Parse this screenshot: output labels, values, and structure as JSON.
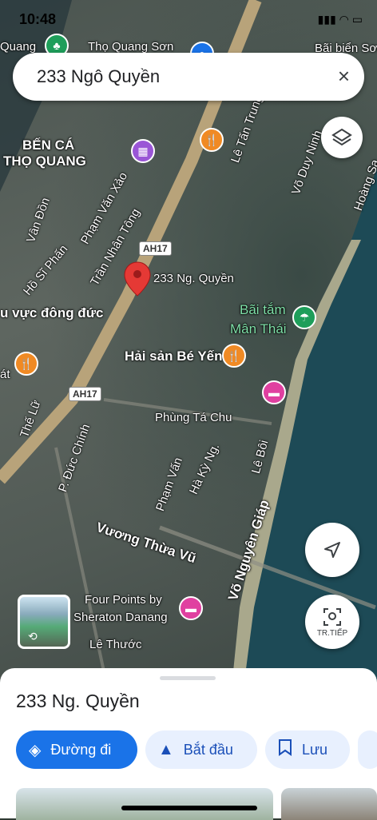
{
  "status": {
    "time": "10:48",
    "icons": "▮▮▮ ◠ ▭"
  },
  "search": {
    "query": "233 Ngô Quyền",
    "close_icon": "×"
  },
  "map_labels": {
    "ben_ca": "BẾN CÁ",
    "tho_quang_area": "THỌ QUANG",
    "quang": "Quang",
    "tho_quang_son": "Thọ Quang Sơn",
    "bai_bien_son": "Bãi biển Sơn",
    "le_tan_trung": "Lê Tấn Trung",
    "vo_duy_ninh": "Võ Duy Ninh",
    "hoang_sa": "Hoàng Sa",
    "van_don": "Vân Đồn",
    "pham_van_xao": "Phạm Văn Xảo",
    "tran_nhan_tong": "Trần Nhân Tông",
    "ho_si_phan": "Hồ Sĩ Phấn",
    "khu_vuc": "u vực đông đức",
    "ah17_top": "AH17",
    "ah17_bottom": "AH17",
    "pin_label": "233 Ng. Quyền",
    "bai_tam_line1": "Bãi tắm",
    "bai_tam_line2": "Mân Thái",
    "hai_san": "Hải sản Bé Yến",
    "phung_ta_chu": "Phùng Tá Chu",
    "the_lu": "Thế Lữ",
    "duc_chinh": "P. Đức Chính",
    "pham_van": "Phạm Vấn",
    "ha_ky_ng": "Hà Kỳ Ng.",
    "le_boi": "Lê Bôi",
    "vuong_thua_vu": "Vương Thừa Vũ",
    "vo_nguyen_giap": "Võ Nguyên Giáp",
    "four_points_1": "Four Points by",
    "four_points_2": "Sheraton Danang",
    "le_thuoc": "Lê Thước",
    "at": "át"
  },
  "controls": {
    "tr_tiep": "TR.TIẾP"
  },
  "sheet": {
    "place_name": "233 Ng. Quyền",
    "directions_label": "Đường đi",
    "start_label": "Bắt đầu",
    "save_label": "Lưu"
  },
  "colors": {
    "accent": "#1a73e8",
    "restaurant": "#f08a24",
    "hotel": "#e040a0",
    "attraction": "#9a56d6",
    "park": "#1e9e5a",
    "pin": "#e53935"
  }
}
